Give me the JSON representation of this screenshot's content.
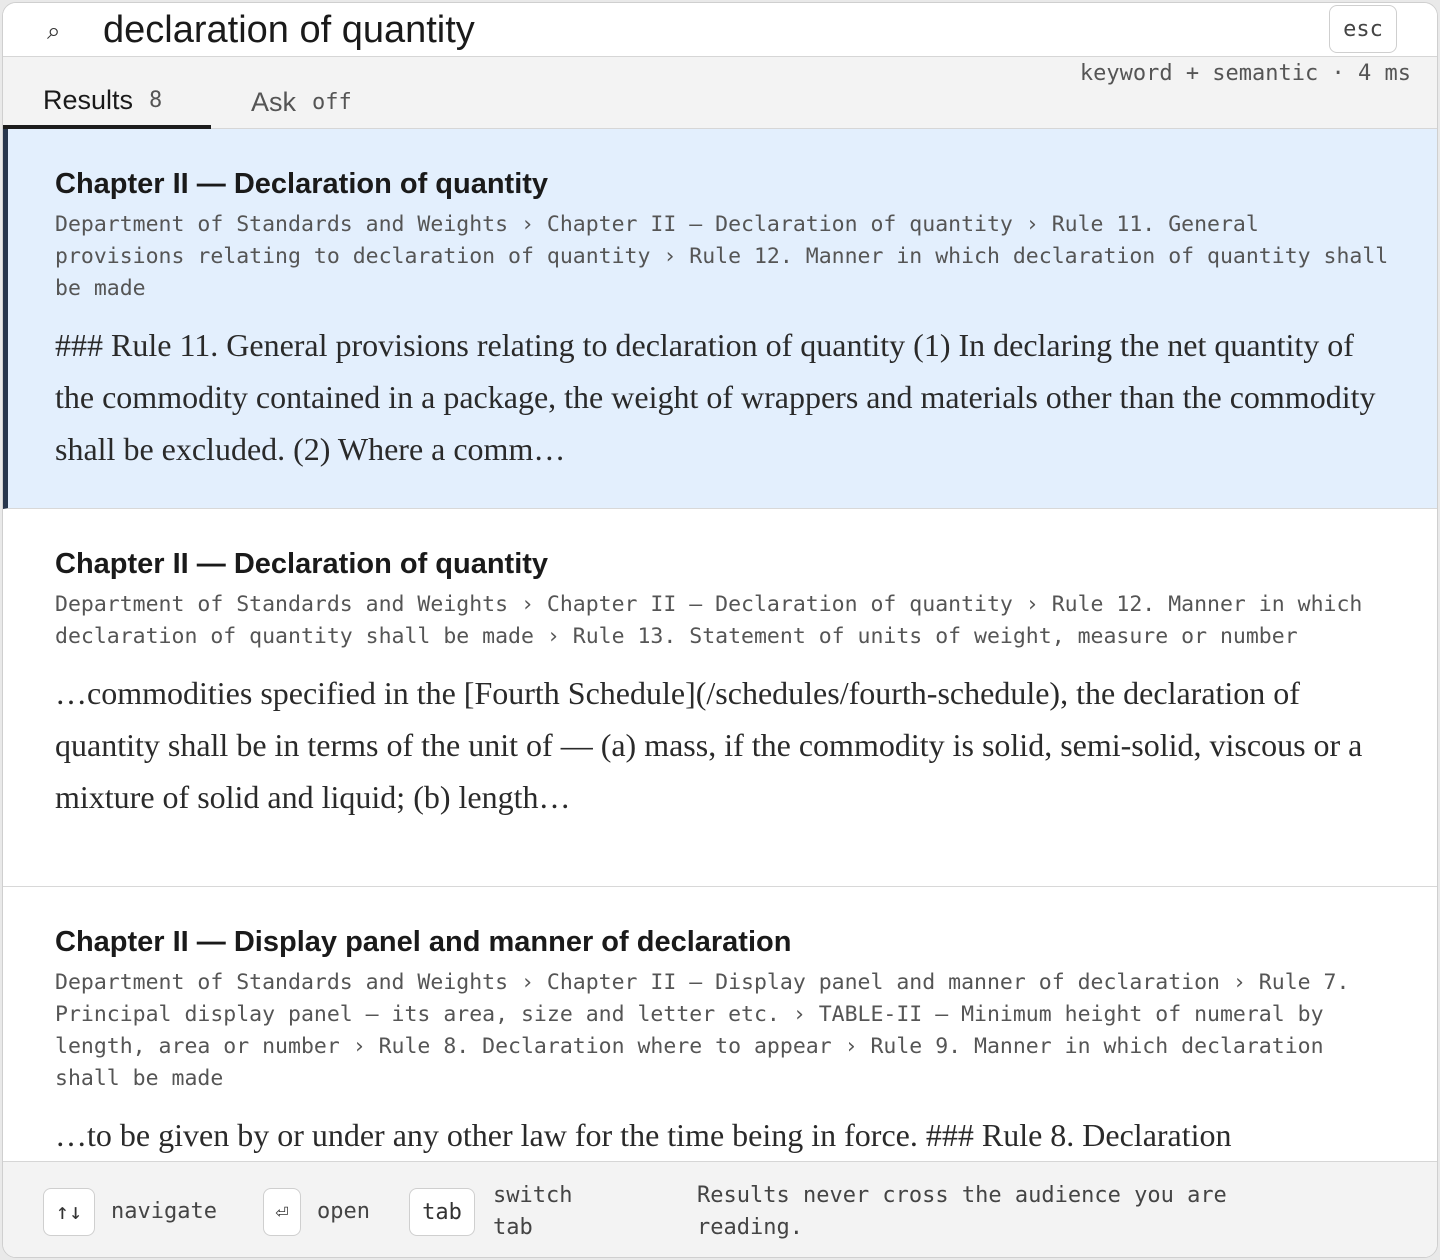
{
  "search": {
    "value": "declaration of quantity",
    "icon": "search-icon",
    "esc_label": "esc"
  },
  "tabs": [
    {
      "label": "Results",
      "badge": "8",
      "active": true
    },
    {
      "label": "Ask",
      "badge": "off",
      "active": false
    }
  ],
  "meta": "keyword + semantic · 4 ms",
  "results": [
    {
      "title": "Chapter II — Declaration of quantity",
      "path": "Department of Standards and Weights › Chapter II — Declaration of quantity › Rule 11. General provisions relating to declaration of quantity › Rule 12. Manner in which declaration of quantity shall be made",
      "snippet": "### Rule 11. General provisions relating to declaration of quantity (1) In declaring the net quantity of the commodity contained in a package, the weight of wrappers and materials other than the commodity shall be excluded. (2) Where a comm…"
    },
    {
      "title": "Chapter II — Declaration of quantity",
      "path": "Department of Standards and Weights › Chapter II — Declaration of quantity › Rule 12. Manner in which declaration of quantity shall be made › Rule 13. Statement of units of weight, measure or number",
      "snippet": "…commodities specified in the [Fourth Schedule](/schedules/fourth-schedule), the declaration of quantity shall be in terms of the unit of — (a) mass, if the commodity is solid, semi-solid, viscous or a mixture of solid and liquid; (b) length…"
    },
    {
      "title": "Chapter II — Display panel and manner of declaration",
      "path": "Department of Standards and Weights › Chapter II — Display panel and manner of declaration › Rule 7. Principal display panel — its area, size and letter etc. › TABLE-II — Minimum height of numeral by length, area or number › Rule 8. Declaration where to appear › Rule 9. Manner in which declaration shall be made",
      "snippet": "…to be given by or under any other law for the time being in force. ### Rule 8. Declaration"
    }
  ],
  "footer": {
    "navigate_key": "↑↓",
    "navigate_label": "navigate",
    "open_key": "⏎",
    "open_label": "open",
    "tab_key": "tab",
    "tab_label_1": "switch",
    "tab_label_2": "tab",
    "note_1": "Results never cross the audience you are",
    "note_2": "reading."
  }
}
